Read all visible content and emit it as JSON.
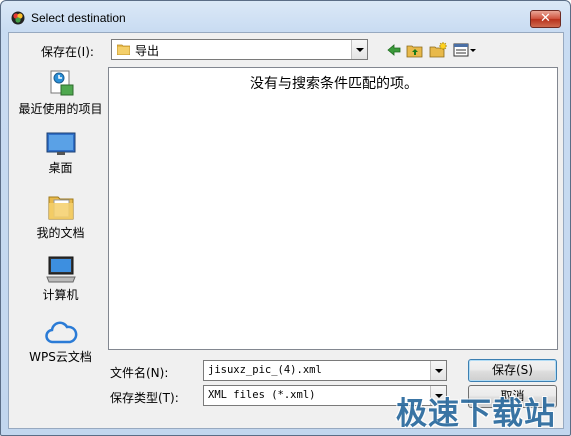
{
  "window": {
    "title": "Select destination",
    "close_label": "✕"
  },
  "lookin": {
    "label": "保存在(I):",
    "value": "导出"
  },
  "toolbar": {
    "back_icon": "back-arrow-icon",
    "up_icon": "folder-up-icon",
    "new_folder_icon": "new-folder-icon",
    "view_icon": "view-menu-icon"
  },
  "places": [
    {
      "label": "最近使用的项目",
      "icon": "recent-items-icon"
    },
    {
      "label": "桌面",
      "icon": "desktop-icon"
    },
    {
      "label": "我的文档",
      "icon": "documents-icon"
    },
    {
      "label": "计算机",
      "icon": "computer-icon"
    },
    {
      "label": "WPS云文档",
      "icon": "cloud-icon"
    }
  ],
  "filelist": {
    "empty_message": "没有与搜索条件匹配的项。"
  },
  "filename": {
    "label": "文件名(N):",
    "value": "jisuxz_pic_(4).xml"
  },
  "filetype": {
    "label": "保存类型(T):",
    "value": "XML files (*.xml)"
  },
  "buttons": {
    "save": "保存(S)",
    "cancel": "取消"
  },
  "watermark": "极速下载站",
  "colors": {
    "accent": "#3c7fb1",
    "close": "#c43c23",
    "folder": "#e8b94a"
  }
}
